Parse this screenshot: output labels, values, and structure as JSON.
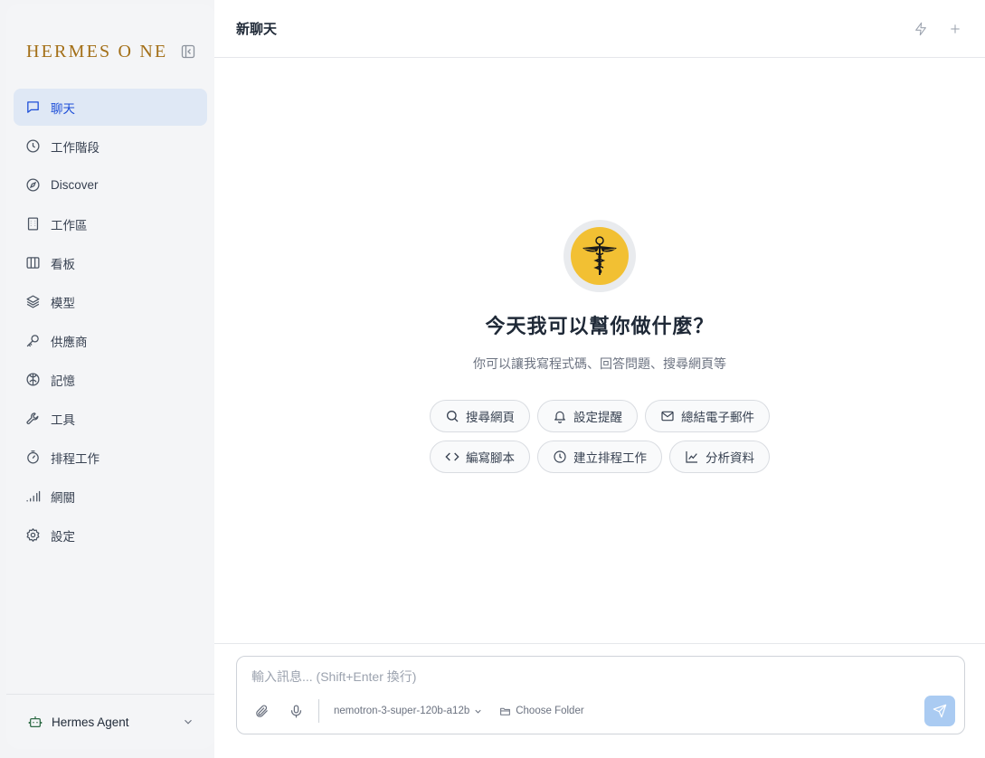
{
  "brand": {
    "name": "HERMES O NE",
    "color": "#a36f17"
  },
  "sidebar": {
    "items": [
      {
        "label": "聊天",
        "icon": "chat-icon",
        "active": true
      },
      {
        "label": "工作階段",
        "icon": "clock-icon"
      },
      {
        "label": "Discover",
        "icon": "compass-icon"
      },
      {
        "label": "工作區",
        "icon": "building-icon"
      },
      {
        "label": "看板",
        "icon": "columns-icon"
      },
      {
        "label": "模型",
        "icon": "layers-icon"
      },
      {
        "label": "供應商",
        "icon": "key-icon"
      },
      {
        "label": "記憶",
        "icon": "brain-icon"
      },
      {
        "label": "工具",
        "icon": "wrench-icon"
      },
      {
        "label": "排程工作",
        "icon": "timer-icon"
      },
      {
        "label": "網關",
        "icon": "signal-icon"
      },
      {
        "label": "設定",
        "icon": "gear-icon"
      }
    ],
    "footer": {
      "agent": "Hermes Agent",
      "icon": "bot-icon"
    }
  },
  "header": {
    "title": "新聊天"
  },
  "welcome": {
    "headline": "今天我可以幫你做什麼？",
    "subline": "你可以讓我寫程式碼、回答問題、搜尋網頁等",
    "chips": [
      [
        {
          "label": "搜尋網頁",
          "icon": "search-icon"
        },
        {
          "label": "設定提醒",
          "icon": "bell-icon"
        },
        {
          "label": "總結電子郵件",
          "icon": "mail-icon"
        }
      ],
      [
        {
          "label": "編寫腳本",
          "icon": "code-icon"
        },
        {
          "label": "建立排程工作",
          "icon": "clock-icon"
        },
        {
          "label": "分析資料",
          "icon": "chart-icon"
        }
      ]
    ]
  },
  "composer": {
    "placeholder": "輸入訊息... (Shift+Enter 換行)",
    "model": "nemotron-3-super-120b-a12b",
    "folder": "Choose Folder"
  },
  "colors": {
    "accent": "#1d4ed8",
    "active_bg": "#dfe8f5",
    "logo_yellow": "#f2c033",
    "send_bg": "#aacbf2"
  }
}
